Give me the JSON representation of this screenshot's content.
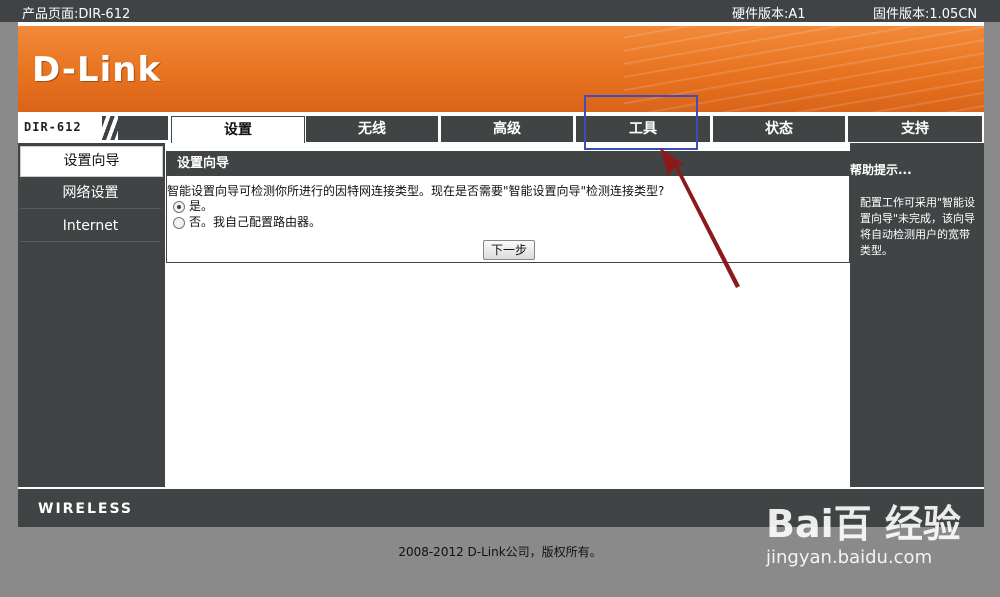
{
  "topbar": {
    "product": "产品页面:DIR-612",
    "hardware": "硬件版本:A1",
    "firmware": "固件版本:1.05CN"
  },
  "brand": {
    "logo": "D-Link",
    "model": "DIR-612",
    "footer_logo": "WIRELESS"
  },
  "tabs": [
    "设置",
    "无线",
    "高级",
    "工具",
    "状态",
    "支持"
  ],
  "active_tab": "设置",
  "sidebar": {
    "items": [
      "设置向导",
      "网络设置",
      "Internet"
    ]
  },
  "wizard": {
    "title": "设置向导",
    "question": "智能设置向导可检测你所进行的因特网连接类型。现在是否需要\"智能设置向导\"检测连接类型?",
    "option_yes": "是。",
    "option_no": "否。我自己配置路由器。",
    "selected": "是。",
    "next_label": "下一步"
  },
  "help": {
    "title": "帮助提示...",
    "body": "配置工作可采用\"智能设置向导\"未完成，该向导将自动检测用户的宽带类型。"
  },
  "copyright": "2008-2012 D-Link公司，版权所有。",
  "annotation": {
    "highlight_color": "#3b4fb8",
    "arrow_color": "#8b1a1a"
  },
  "watermark": {
    "main": "Bai百 经验",
    "sub": "jingyan.baidu.com"
  }
}
